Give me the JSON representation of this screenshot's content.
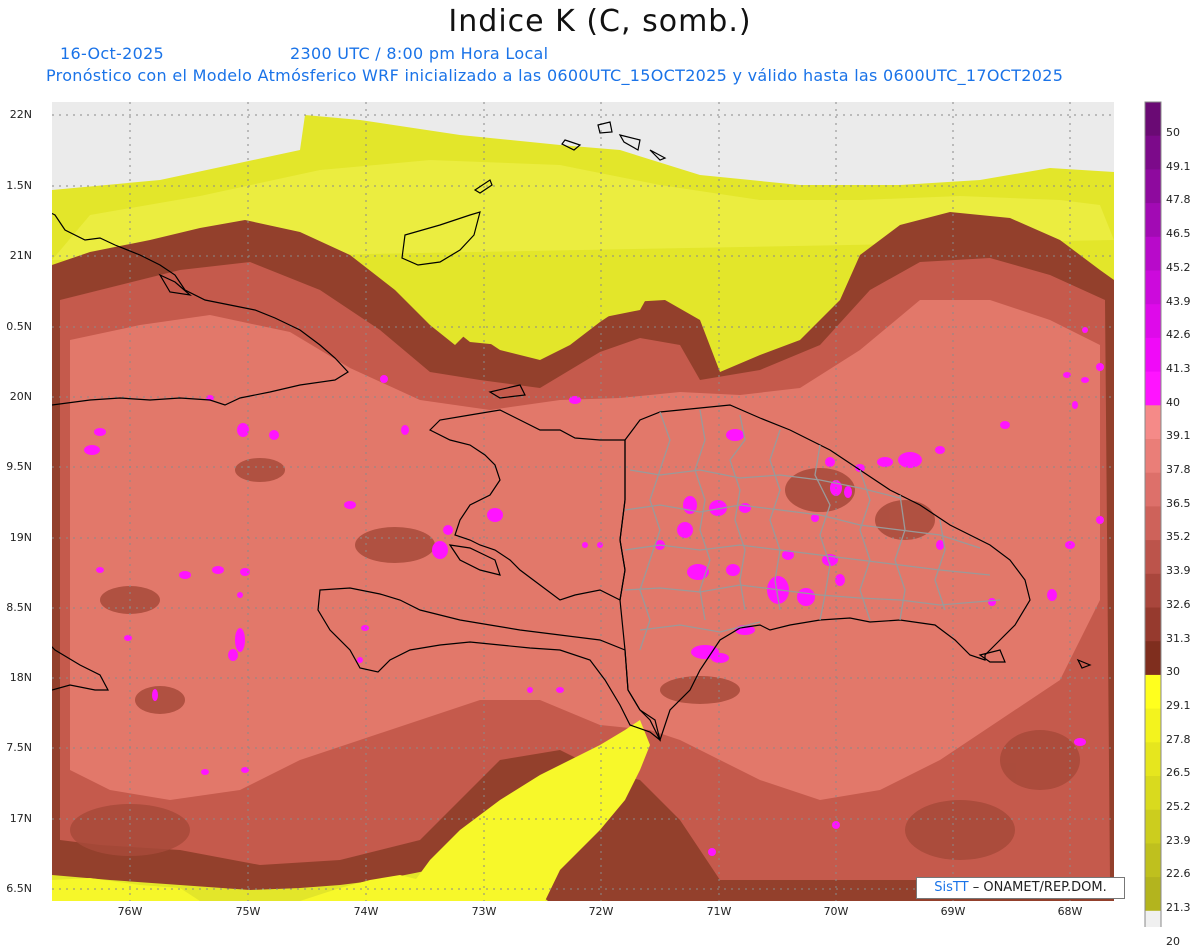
{
  "header": {
    "title": "Indice K (C, somb.)",
    "date": "16-Oct-2025",
    "time": "2300 UTC / 8:00 pm Hora Local",
    "model_line": "Pronóstico con el Modelo Atmósferico WRF inicializado a las 0600UTC_15OCT2025 y válido hasta las  0600UTC_17OCT2025"
  },
  "latitude_labels": [
    "22N",
    "1.5N",
    "21N",
    "0.5N",
    "20N",
    "9.5N",
    "19N",
    "8.5N",
    "18N",
    "7.5N",
    "17N",
    "6.5N"
  ],
  "longitude_labels": [
    "76W",
    "75W",
    "74W",
    "73W",
    "72W",
    "71W",
    "70W",
    "69W",
    "68W"
  ],
  "colorbar": {
    "labels": [
      "50",
      "49.1",
      "47.8",
      "46.5",
      "45.2",
      "43.9",
      "42.6",
      "41.3",
      "40",
      "39.1",
      "37.8",
      "36.5",
      "35.2",
      "33.9",
      "32.6",
      "31.3",
      "30",
      "29.1",
      "27.8",
      "26.5",
      "25.2",
      "23.9",
      "22.6",
      "21.3",
      "20"
    ],
    "colors": [
      "#6a0a74",
      "#7c0a8a",
      "#8e0a9e",
      "#a20ab4",
      "#b80aca",
      "#cc0adc",
      "#de0aea",
      "#f00af8",
      "#ff14ff",
      "#f58a88",
      "#ea7e78",
      "#dd706a",
      "#ce625a",
      "#bc544b",
      "#a9463c",
      "#963a2e",
      "#7f2e1e",
      "#ffff1e",
      "#f3f31e",
      "#e6e61e",
      "#d9da1e",
      "#cccd1e",
      "#bfc01e",
      "#b3b41e",
      "#f0f0f0"
    ]
  },
  "credit": {
    "brand": "SisTT",
    "text": "– ONAMET/REP.DOM."
  },
  "field_colors": {
    "background_gray": "#ebebeb",
    "dry_yellow": "#e6e82a",
    "dark_brown": "#8f3a28",
    "mid_red": "#c75a4e",
    "salmon": "#e47a6e",
    "magenta": "#ff14ff",
    "coast": "#000000",
    "provinces": "#9a9a9a"
  }
}
